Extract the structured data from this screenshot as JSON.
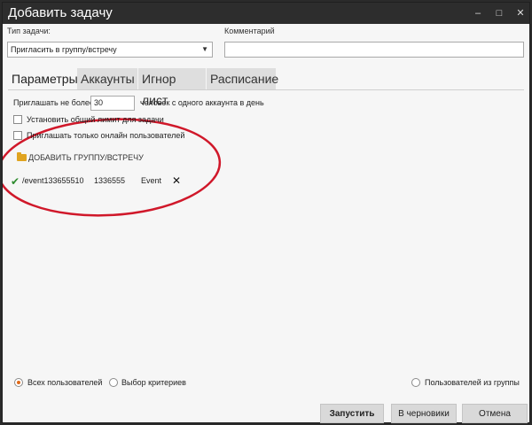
{
  "window": {
    "title": "Добавить задачу",
    "buttons": {
      "minimize": "–",
      "maximize": "□",
      "close": "✕"
    }
  },
  "form": {
    "task_type_label": "Тип задачи:",
    "task_type_value": "Пригласить в группу/встречу",
    "comment_label": "Комментарий",
    "comment_value": ""
  },
  "tabs": [
    {
      "label": "Параметры",
      "active": true
    },
    {
      "label": "Аккаунты",
      "active": false
    },
    {
      "label": "Игнор лист",
      "active": false
    },
    {
      "label": "Расписание",
      "active": false
    }
  ],
  "params": {
    "invite_prefix": "Приглашать не более",
    "invite_count": "30",
    "invite_suffix": "человек с одного аккаунта в день",
    "common_limit_label": "Установить общий лимит для задачи",
    "online_only_label": "Приглашать только онлайн пользователей",
    "add_group_label": "ДОБАВИТЬ ГРУППУ/ВСТРЕЧУ",
    "group_entry": {
      "path": "/event133655510",
      "id": "1336555",
      "type": "Event"
    }
  },
  "audience": {
    "all_users": "Всех пользователей",
    "criteria": "Выбор критериев",
    "group_users": "Пользователей из группы"
  },
  "footer": {
    "start": "Запустить",
    "drafts": "В черновики",
    "cancel": "Отмена"
  },
  "colors": {
    "titlebar": "#2d2d2d",
    "window_bg": "#f6f6f6",
    "annotation": "#d0182a",
    "check": "#2e8b2e",
    "radio_selected": "#e06a1a"
  }
}
